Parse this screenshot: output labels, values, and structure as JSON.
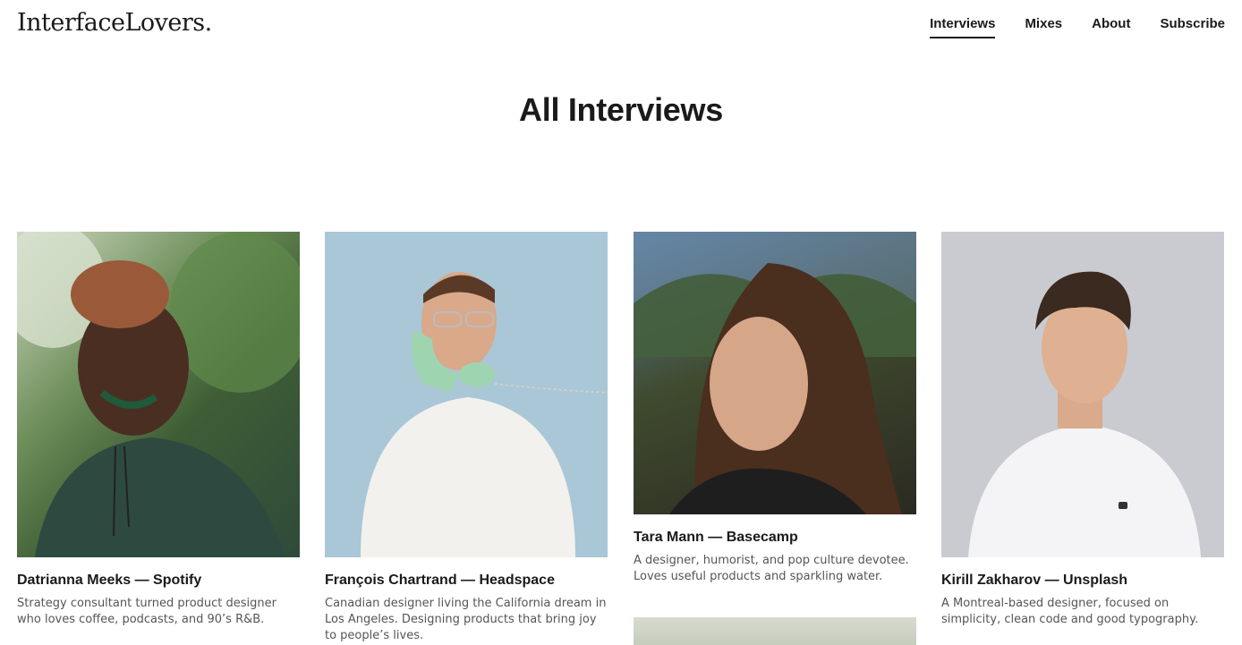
{
  "header": {
    "logo": "InterfaceLovers.",
    "nav": [
      {
        "label": "Interviews"
      },
      {
        "label": "Mixes"
      },
      {
        "label": "About"
      },
      {
        "label": "Subscribe"
      }
    ]
  },
  "page": {
    "title": "All Interviews"
  },
  "interviews": [
    {
      "title": "Datrianna Meeks — Spotify",
      "desc": "Strategy consultant turned product designer who loves coffee, podcasts, and 90’s R&B."
    },
    {
      "title": "François Chartrand — Headspace",
      "desc": "Canadian designer living the California dream in Los Angeles. Designing products that bring joy to people’s lives."
    },
    {
      "title": "Tara Mann — Basecamp",
      "desc": "A designer, humorist, and pop culture devotee. Loves useful products and sparkling water."
    },
    {
      "title": "Kirill Zakharov — Unsplash",
      "desc": "A Montreal-based designer, focused on simplicity, clean code and good typography."
    }
  ]
}
